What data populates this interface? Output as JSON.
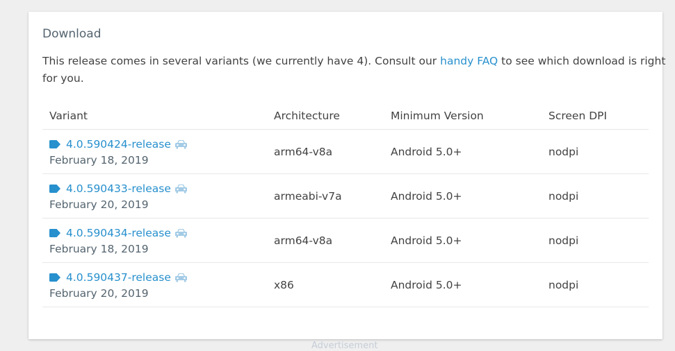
{
  "download": {
    "title": "Download",
    "intro_before": "This release comes in several variants (we currently have 4). Consult our",
    "faq_link": "handy FAQ",
    "intro_after": "to see which download is right",
    "intro_line2": "for you."
  },
  "table": {
    "headers": [
      "Variant",
      "Architecture",
      "Minimum Version",
      "Screen DPI"
    ],
    "rows": [
      {
        "version": "4.0.590424-release",
        "date": "February 18, 2019",
        "architecture": "arm64-v8a",
        "min_version": "Android 5.0+",
        "dpi": "nodpi"
      },
      {
        "version": "4.0.590433-release",
        "date": "February 20, 2019",
        "architecture": "armeabi-v7a",
        "min_version": "Android 5.0+",
        "dpi": "nodpi"
      },
      {
        "version": "4.0.590434-release",
        "date": "February 18, 2019",
        "architecture": "arm64-v8a",
        "min_version": "Android 5.0+",
        "dpi": "nodpi"
      },
      {
        "version": "4.0.590437-release",
        "date": "February 20, 2019",
        "architecture": "x86",
        "min_version": "Android 5.0+",
        "dpi": "nodpi"
      }
    ]
  },
  "advertisement": "Advertisement",
  "icons": {
    "tag": "tag-icon",
    "car": "car-icon"
  },
  "colors": {
    "link": "#2790cd",
    "car_icon": "#a3cbe6",
    "text": "#424242",
    "muted": "#54646f"
  }
}
